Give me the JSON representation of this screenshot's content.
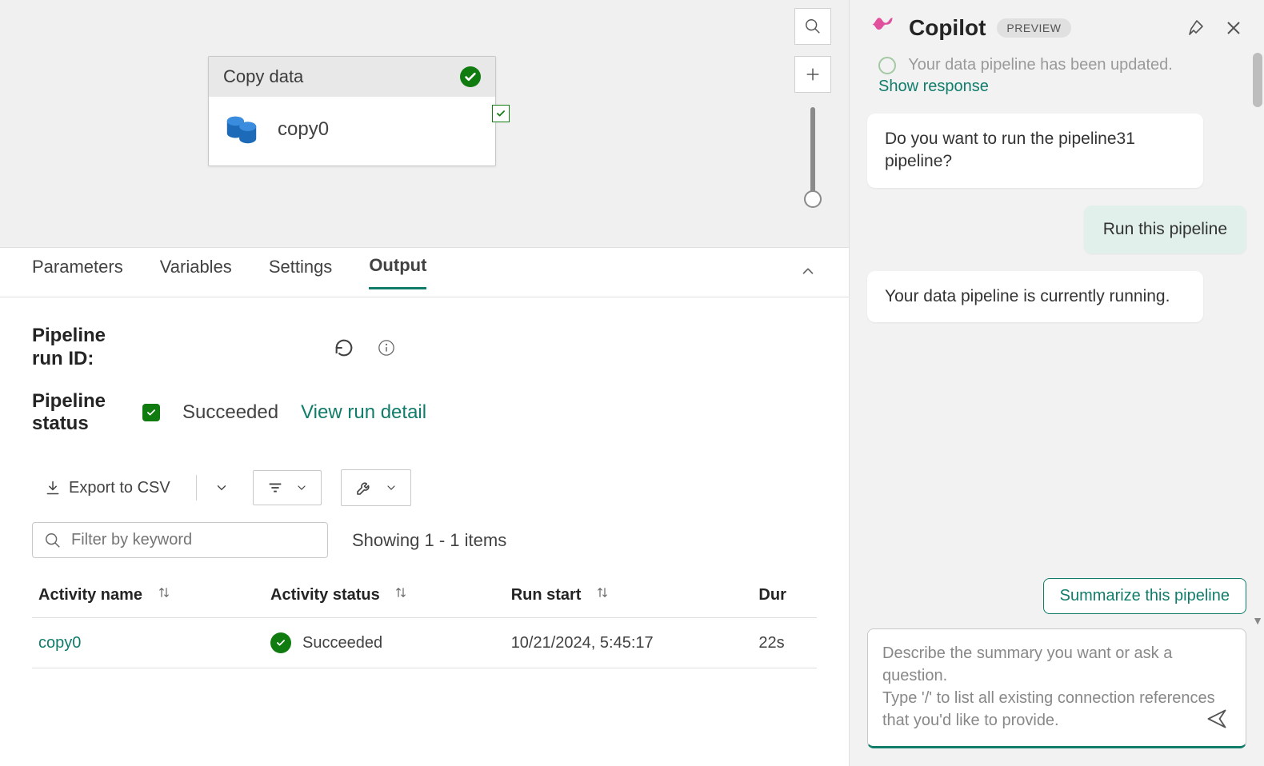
{
  "canvas": {
    "activity": {
      "title": "Copy data",
      "name": "copy0"
    }
  },
  "tabs": {
    "parameters": "Parameters",
    "variables": "Variables",
    "settings": "Settings",
    "output": "Output"
  },
  "output": {
    "run_id_label": "Pipeline run ID:",
    "status_label": "Pipeline status",
    "status_value": "Succeeded",
    "view_run_detail": "View run detail",
    "export_csv": "Export to CSV",
    "filter_placeholder": "Filter by keyword",
    "showing": "Showing 1 - 1 items",
    "columns": {
      "activity_name": "Activity name",
      "activity_status": "Activity status",
      "run_start": "Run start",
      "duration": "Dur"
    },
    "rows": [
      {
        "name": "copy0",
        "status": "Succeeded",
        "start": "10/21/2024, 5:45:17",
        "duration": "22s"
      }
    ]
  },
  "copilot": {
    "title": "Copilot",
    "badge": "PREVIEW",
    "truncated": "Your data pipeline has been updated.",
    "show_response": "Show response",
    "messages": {
      "m1": "Do you want to run the pipeline31 pipeline?",
      "action": "Run this pipeline",
      "m2": "Your data pipeline is currently running."
    },
    "suggestion": "Summarize this pipeline",
    "composer_placeholder": "Describe the summary you want or ask a question.\nType '/' to list all existing connection references that you'd like to provide."
  }
}
